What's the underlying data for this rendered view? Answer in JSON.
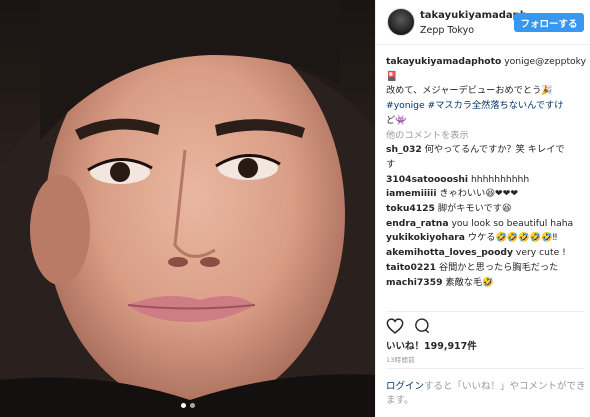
{
  "post": {
    "username": "takayukiyamadaph",
    "location": "Zepp Tokyo",
    "follow_label": "フォローする"
  },
  "caption": {
    "username": "takayukiyamadaphoto",
    "line1_text": " yonige@zepptokyo",
    "line2_text": "改めて、メジャーデビューおめでとう",
    "tag1": "#yonige",
    "tag2": "#マスカラ全然落ちないんですけ",
    "line4_text": "ど"
  },
  "more_comments_label": "他のコメントを表示",
  "comments": [
    {
      "user": "sh_032",
      "text": " 何やってるんですか？笑 キレイで"
    },
    {
      "user": "",
      "text": "す"
    },
    {
      "user": "3104satooooshi",
      "text": " hhhhhhhhhh"
    },
    {
      "user": "iamemiiiii",
      "text": " きゃわいい"
    },
    {
      "user": "toku4125",
      "text": " 脚がキモいです"
    },
    {
      "user": "endra_ratna",
      "text": " you look so beautiful haha"
    },
    {
      "user": "yukikokiyohara",
      "text": " ウケる"
    },
    {
      "user": "akemihotta_loves_poody",
      "text": " very cute !"
    },
    {
      "user": "taito0221",
      "text": " 谷間かと思ったら胸毛だった"
    },
    {
      "user": "machi7359",
      "text": " 素敵な毛"
    }
  ],
  "icons": {
    "like": "heart-icon",
    "comment": "comment-icon",
    "avatar": "avatar"
  },
  "likes_text": "いいね！199,917件",
  "time_text": "13時間前",
  "login": {
    "link": "ログイン",
    "rest": "すると「いいね！」やコメントができます。"
  },
  "colors": {
    "follow_button": "#3897f0",
    "hashtag": "#003569",
    "muted": "#999999"
  }
}
